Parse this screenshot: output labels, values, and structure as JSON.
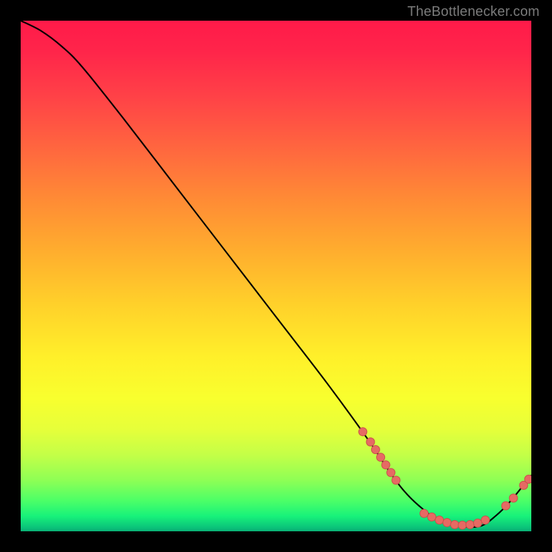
{
  "attribution": "TheBottlenecker.com",
  "chart_data": {
    "type": "line",
    "title": "",
    "xlabel": "",
    "ylabel": "",
    "xlim": [
      0,
      100
    ],
    "ylim": [
      0,
      100
    ],
    "series": [
      {
        "name": "bottleneck-curve",
        "x": [
          0,
          4,
          8,
          12,
          20,
          30,
          40,
          50,
          60,
          68,
          72,
          75,
          78,
          82,
          86,
          90,
          93,
          96,
          100
        ],
        "y": [
          100,
          98,
          95,
          91,
          81,
          68,
          55,
          42,
          29,
          18,
          12,
          8,
          5,
          2,
          1,
          1,
          3,
          6,
          11
        ]
      }
    ],
    "markers": [
      {
        "name": "cluster-descent",
        "points": [
          {
            "x": 67.0,
            "y": 19.5
          },
          {
            "x": 68.5,
            "y": 17.5
          },
          {
            "x": 69.5,
            "y": 16.0
          },
          {
            "x": 70.5,
            "y": 14.5
          },
          {
            "x": 71.5,
            "y": 13.0
          },
          {
            "x": 72.5,
            "y": 11.5
          },
          {
            "x": 73.5,
            "y": 10.0
          }
        ]
      },
      {
        "name": "cluster-trough",
        "points": [
          {
            "x": 79.0,
            "y": 3.5
          },
          {
            "x": 80.5,
            "y": 2.8
          },
          {
            "x": 82.0,
            "y": 2.2
          },
          {
            "x": 83.5,
            "y": 1.7
          },
          {
            "x": 85.0,
            "y": 1.3
          },
          {
            "x": 86.5,
            "y": 1.2
          },
          {
            "x": 88.0,
            "y": 1.3
          },
          {
            "x": 89.5,
            "y": 1.6
          },
          {
            "x": 91.0,
            "y": 2.2
          }
        ]
      },
      {
        "name": "cluster-ascent",
        "points": [
          {
            "x": 95.0,
            "y": 5.0
          },
          {
            "x": 96.5,
            "y": 6.5
          },
          {
            "x": 98.5,
            "y": 9.0
          },
          {
            "x": 99.5,
            "y": 10.2
          }
        ]
      }
    ],
    "colors": {
      "curve": "#000000",
      "marker_fill": "#e66a63",
      "marker_stroke": "#c94f4a"
    }
  }
}
